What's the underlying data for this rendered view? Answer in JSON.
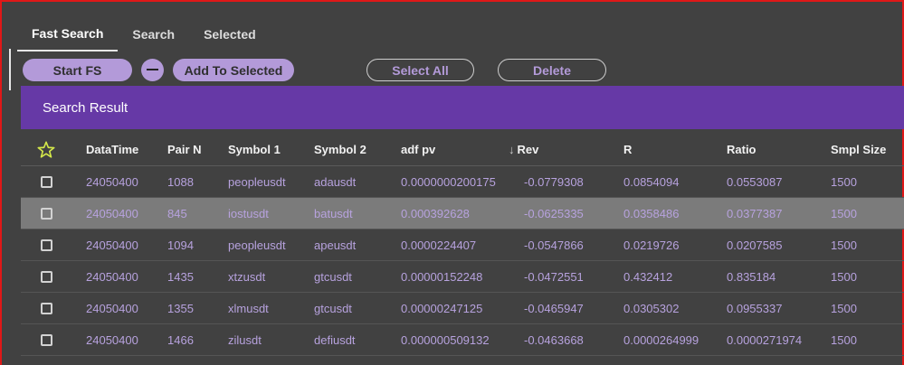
{
  "tabs": [
    "Fast Search",
    "Search",
    "Selected"
  ],
  "toolbar": {
    "start_label": "Start FS",
    "add_label": "Add To Selected",
    "select_all_label": "Select All",
    "delete_label": "Delete"
  },
  "result_title": "Search Result",
  "table": {
    "headers": [
      "DataTime",
      "Pair N",
      "Symbol 1",
      "Symbol 2",
      "adf pv",
      "Rev",
      "R",
      "Ratio",
      "Smpl Size"
    ],
    "sort_column": "Rev",
    "sort_direction": "descending",
    "rows": [
      [
        "24050400",
        "1088",
        "peopleusdt",
        "adausdt",
        "0.0000000200175",
        "-0.0779308",
        "0.0854094",
        "0.0553087",
        "1500"
      ],
      [
        "24050400",
        "845",
        "iostusdt",
        "batusdt",
        "0.000392628",
        "-0.0625335",
        "0.0358486",
        "0.0377387",
        "1500"
      ],
      [
        "24050400",
        "1094",
        "peopleusdt",
        "apeusdt",
        "0.0000224407",
        "-0.0547866",
        "0.0219726",
        "0.0207585",
        "1500"
      ],
      [
        "24050400",
        "1435",
        "xtzusdt",
        "gtcusdt",
        "0.00000152248",
        "-0.0472551",
        "0.432412",
        "0.835184",
        "1500"
      ],
      [
        "24050400",
        "1355",
        "xlmusdt",
        "gtcusdt",
        "0.00000247125",
        "-0.0465947",
        "0.0305302",
        "0.0955337",
        "1500"
      ],
      [
        "24050400",
        "1466",
        "zilusdt",
        "defiusdt",
        "0.000000509132",
        "-0.0463668",
        "0.0000264999",
        "0.0000271974",
        "1500"
      ]
    ]
  },
  "colors": {
    "accent": "#6639a6",
    "button": "#b39ad9",
    "background": "#414141",
    "highlight_row": "#7b7b7b",
    "star": "#d4e84a"
  },
  "icons": {
    "favorite_column": "star-icon",
    "sort": "arrow-down-icon",
    "remove": "minus-icon"
  }
}
